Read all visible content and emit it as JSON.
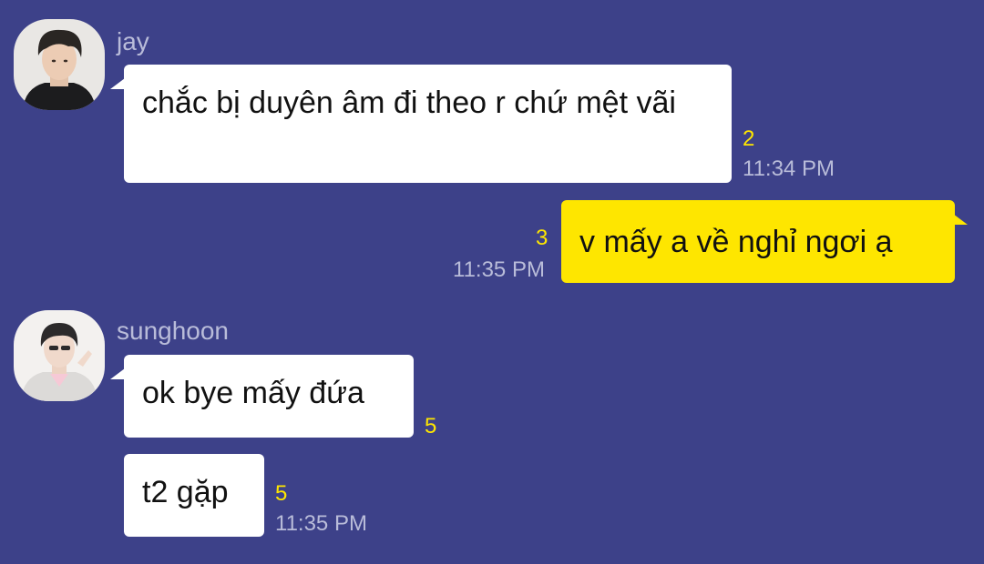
{
  "messages": [
    {
      "sender": "jay",
      "avatar": "profile-photo",
      "text": "chắc bị duyên âm đi theo r chứ mệt vãi",
      "unread": "2",
      "time": "11:34 PM"
    },
    {
      "sender": "me",
      "text": "v mấy a về nghỉ ngơi ạ",
      "unread": "3",
      "time": "11:35 PM"
    },
    {
      "sender": "sunghoon",
      "avatar": "profile-photo",
      "text": "ok bye mấy đứa",
      "unread": "5",
      "time": ""
    },
    {
      "sender": "sunghoon",
      "text": "t2 gặp",
      "unread": "5",
      "time": "11:35 PM"
    }
  ],
  "colors": {
    "background": "#3d4189",
    "my_bubble": "#fee600",
    "other_bubble": "#ffffff",
    "unread_count": "#fee600",
    "meta_text": "#b9bcd9"
  }
}
